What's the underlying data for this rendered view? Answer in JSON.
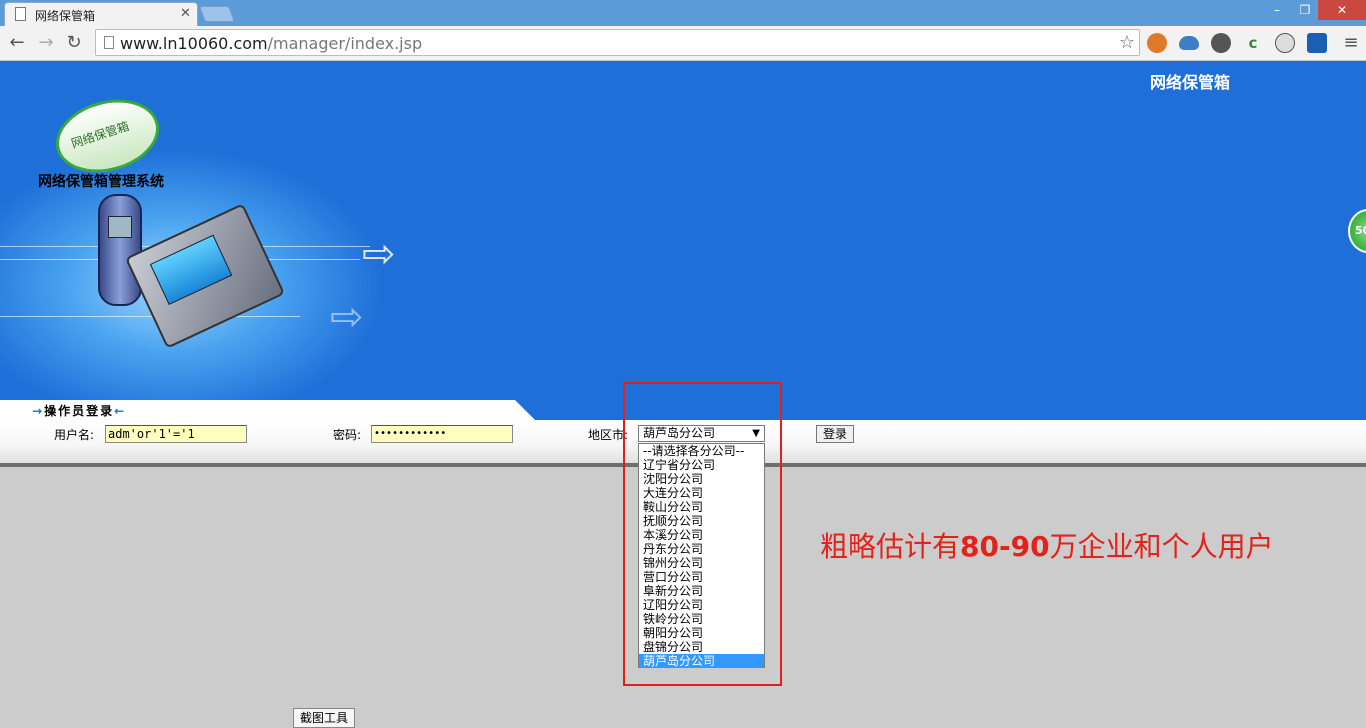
{
  "browser": {
    "tab_title": "网络保管箱",
    "url_domain": "www.ln10060.com",
    "url_path": "/manager/index.jsp",
    "window_buttons": {
      "minimize": "–",
      "maximize": "❐",
      "close": "✕"
    },
    "extensions": [
      "ext-orange-globe-icon",
      "cloud-icon",
      "gear-icon",
      "c-icon",
      "mask-icon",
      "blue-app-icon"
    ]
  },
  "banner": {
    "header_title": "网络保管箱",
    "logo_text": "网络保管箱",
    "system_title": "网络保管箱管理系统",
    "side_badge": "50"
  },
  "login": {
    "heading": "操作员登录",
    "username_label": "用户名:",
    "username_value": "adm'or'1'='1",
    "password_label": "密码:",
    "password_value": "••••••••••••",
    "region_label": "地区市:",
    "region_selected": "葫芦岛分公司",
    "submit_label": "登录",
    "region_options": [
      "--请选择各分公司--",
      "辽宁省分公司",
      "沈阳分公司",
      "大连分公司",
      "鞍山分公司",
      "抚顺分公司",
      "本溪分公司",
      "丹东分公司",
      "锦州分公司",
      "营口分公司",
      "阜新分公司",
      "辽阳分公司",
      "铁岭分公司",
      "朝阳分公司",
      "盘锦分公司",
      "葫芦岛分公司"
    ]
  },
  "annotation": {
    "prefix": "粗略估计有",
    "number": "80-90",
    "suffix": "万企业和个人用户"
  },
  "taskbar": {
    "snip_tool_label": "截图工具"
  },
  "colors": {
    "banner_blue": "#1e6fd8",
    "annotation_red": "#e2231a",
    "input_yellow": "#ffffc0",
    "selection_blue": "#3399ff"
  }
}
